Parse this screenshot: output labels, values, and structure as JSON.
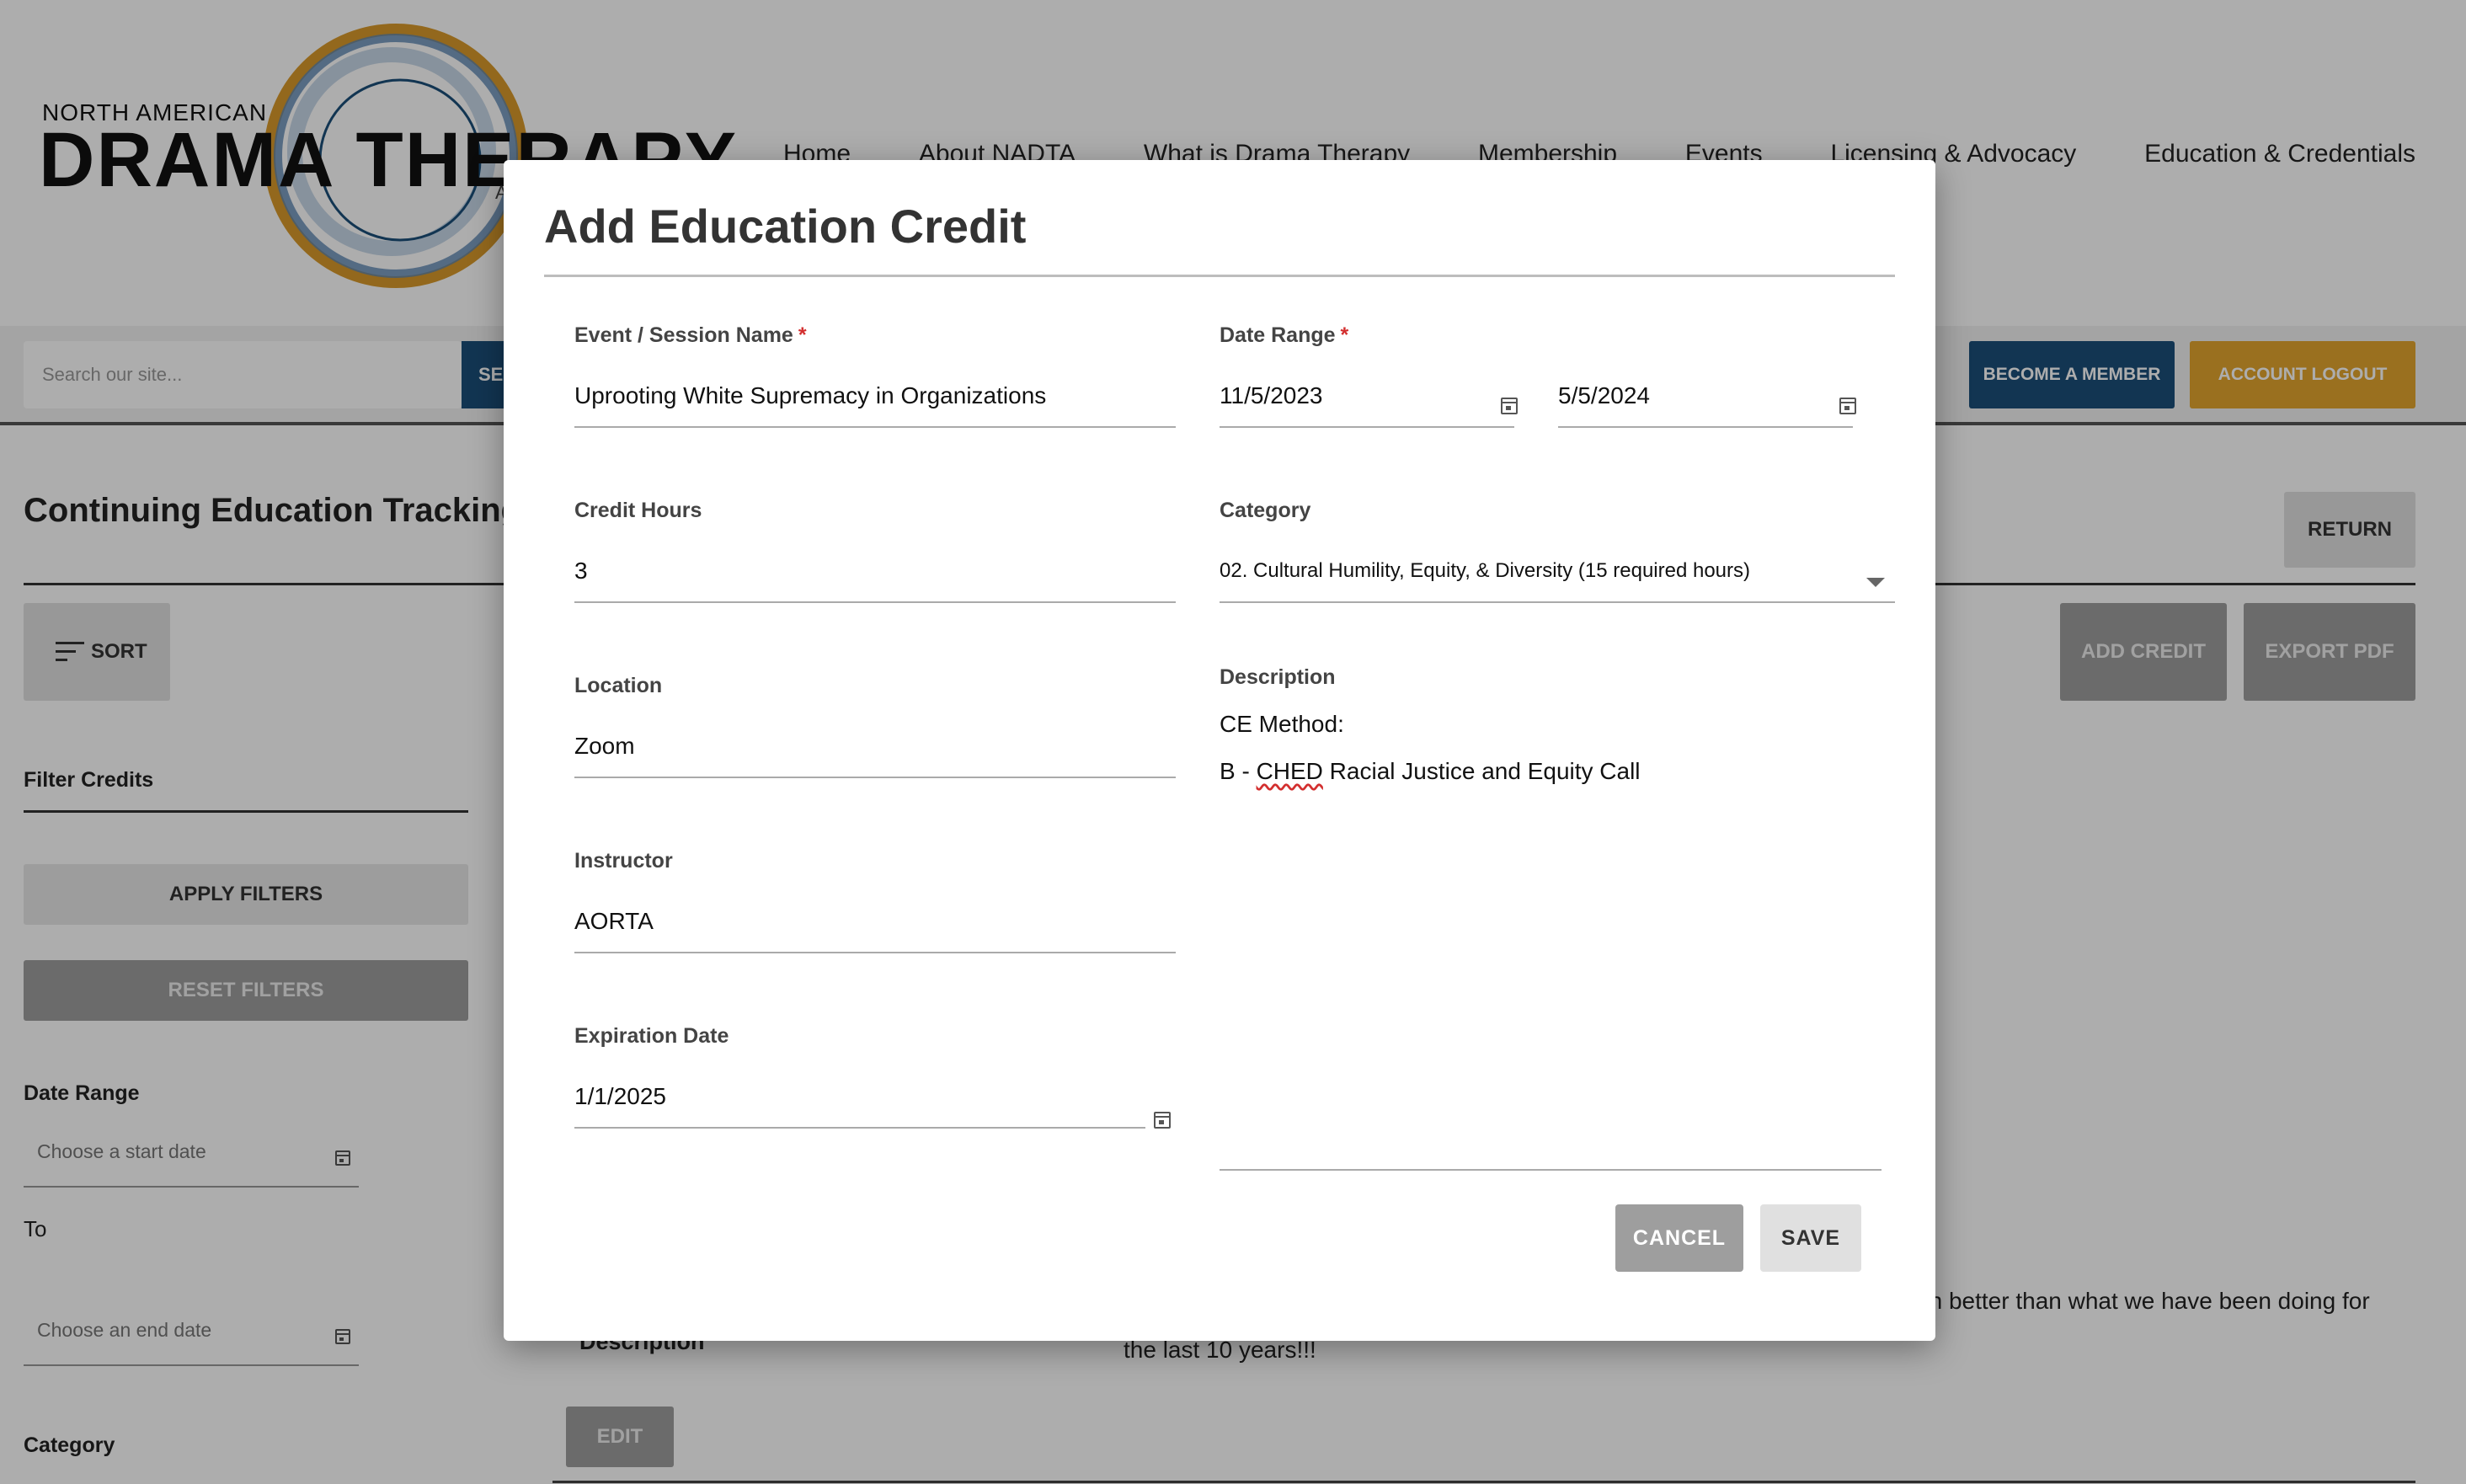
{
  "site": {
    "logo_top_text": "NORTH AMERICAN",
    "logo_main_text": "DRAMA THERAPY",
    "logo_sub_text": "A",
    "nav": [
      "Home",
      "About NADTA",
      "What is Drama Therapy",
      "Membership",
      "Events",
      "Licensing & Advocacy",
      "Education & Credentials"
    ],
    "search_placeholder": "Search our site...",
    "search_button": "SEA",
    "become_member": "BECOME A MEMBER",
    "account_logout": "ACCOUNT LOGOUT",
    "colors": {
      "navy": "#1b4f7a",
      "gold": "#e3a52e"
    }
  },
  "page": {
    "title": "Continuing Education Tracking",
    "return_button": "RETURN",
    "sort_button": "SORT",
    "add_credit_button": "ADD CREDIT",
    "export_pdf_button": "EXPORT PDF",
    "filter_title": "Filter Credits",
    "apply_filters": "APPLY FILTERS",
    "reset_filters": "RESET FILTERS",
    "date_range_label": "Date Range",
    "start_date_placeholder": "Choose a start date",
    "to_label": "To",
    "end_date_placeholder": "Choose an end date",
    "category_label": "Category",
    "bg_description_label": "Description",
    "bg_description_text": "how to activate the Continuing Education tab in Memberclicks. This is so much better than what we have been doing for the last 10 years!!!",
    "edit_button": "EDIT"
  },
  "dialog": {
    "title": "Add Education Credit",
    "event_label": "Event / Session Name",
    "event_value": "Uprooting White Supremacy in Organizations",
    "date_range_label": "Date Range",
    "date_start": "11/5/2023",
    "date_end": "5/5/2024",
    "credit_hours_label": "Credit Hours",
    "credit_hours_value": "3",
    "category_label": "Category",
    "category_value": "02. Cultural Humility, Equity, & Diversity (15 required hours)",
    "location_label": "Location",
    "location_value": "Zoom",
    "description_label": "Description",
    "description_line1": "CE Method:",
    "description_line2_prefix": "B - ",
    "description_line2_misspelled": "CHED",
    "description_line2_suffix": " Racial Justice and Equity Call",
    "instructor_label": "Instructor",
    "instructor_value": "AORTA",
    "expiration_label": "Expiration Date",
    "expiration_value": "1/1/2025",
    "required_marker": "*",
    "cancel_button": "CANCEL",
    "save_button": "SAVE"
  }
}
